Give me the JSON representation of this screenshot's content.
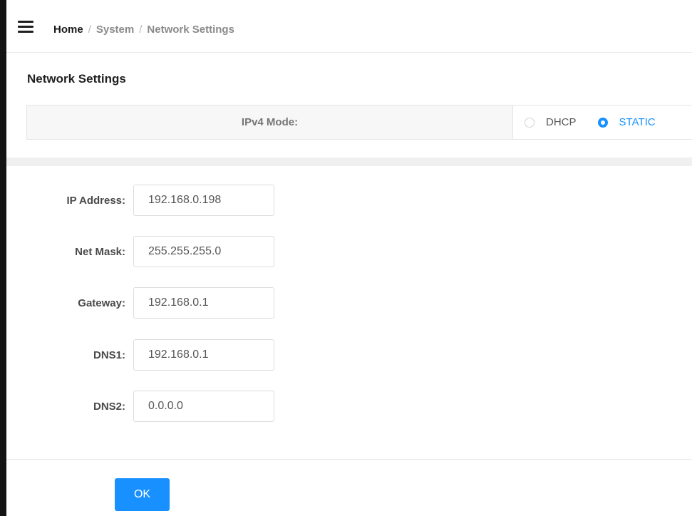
{
  "breadcrumb": {
    "home": "Home",
    "separator": "/",
    "system": "System",
    "current": "Network Settings"
  },
  "section": {
    "title": "Network Settings"
  },
  "ipv4_mode": {
    "label": "IPv4 Mode:",
    "options": [
      {
        "label": "DHCP",
        "selected": false
      },
      {
        "label": "STATIC",
        "selected": true
      }
    ]
  },
  "form": {
    "ip_address": {
      "label": "IP Address:",
      "value": "192.168.0.198"
    },
    "net_mask": {
      "label": "Net Mask:",
      "value": "255.255.255.0"
    },
    "gateway": {
      "label": "Gateway:",
      "value": "192.168.0.1"
    },
    "dns1": {
      "label": "DNS1:",
      "value": "192.168.0.1"
    },
    "dns2": {
      "label": "DNS2:",
      "value": "0.0.0.0"
    }
  },
  "actions": {
    "ok_label": "OK"
  },
  "colors": {
    "accent": "#1890ff",
    "window_border": "#141414",
    "label_cell_bg": "#f7f7f7"
  },
  "icons": {
    "menu": "hamburger-menu-icon"
  }
}
